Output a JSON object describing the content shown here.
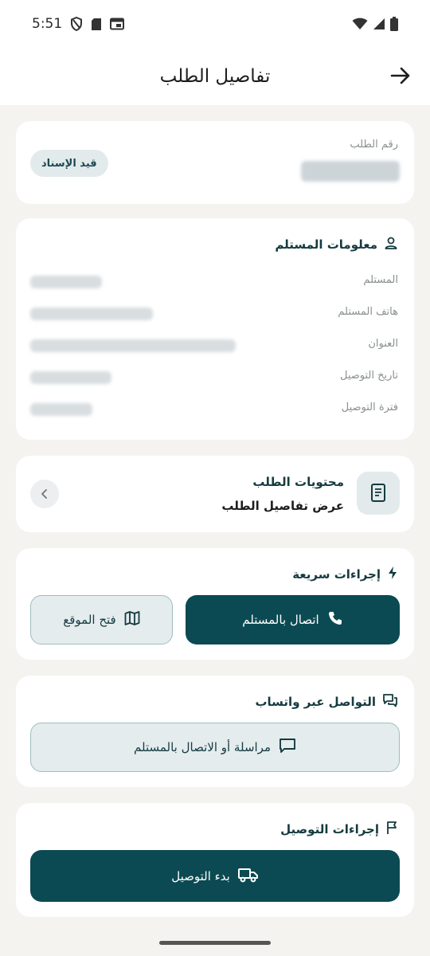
{
  "status_bar": {
    "time": "5:51",
    "icons": [
      "shield-icon",
      "sd-card-icon",
      "calendar-icon",
      "wifi-icon",
      "signal-icon",
      "battery-icon"
    ]
  },
  "header": {
    "title": "تفاصيل الطلب",
    "back_icon": "arrow-right-icon"
  },
  "order_card": {
    "order_number_label": "رقم الطلب",
    "status_badge": "قيد الإسناد"
  },
  "recipient_card": {
    "title": "معلومات المستلم",
    "icon": "user-icon",
    "rows": [
      {
        "label": "المستلم"
      },
      {
        "label": "هاتف المستلم"
      },
      {
        "label": "العنوان"
      },
      {
        "label": "تاريخ التوصيل"
      },
      {
        "label": "فترة التوصيل"
      }
    ]
  },
  "contents_card": {
    "title": "محتويات الطلب",
    "subtitle": "عرض تفاصيل الطلب",
    "icon": "receipt-icon"
  },
  "quick_actions": {
    "title": "إجراءات سريعة",
    "icon": "lightning-icon",
    "call_button": "اتصال بالمستلم",
    "location_button": "فتح الموقع"
  },
  "whatsapp": {
    "title": "التواصل عبر واتساب",
    "icon": "chat-icon",
    "button": "مراسلة أو الاتصال بالمستلم"
  },
  "delivery_actions": {
    "title": "إجراءات التوصيل",
    "icon": "flag-icon",
    "button": "بدء التوصيل"
  },
  "colors": {
    "primary": "#0b4a52",
    "light": "#e4ecee",
    "background": "#f4f3f0"
  }
}
